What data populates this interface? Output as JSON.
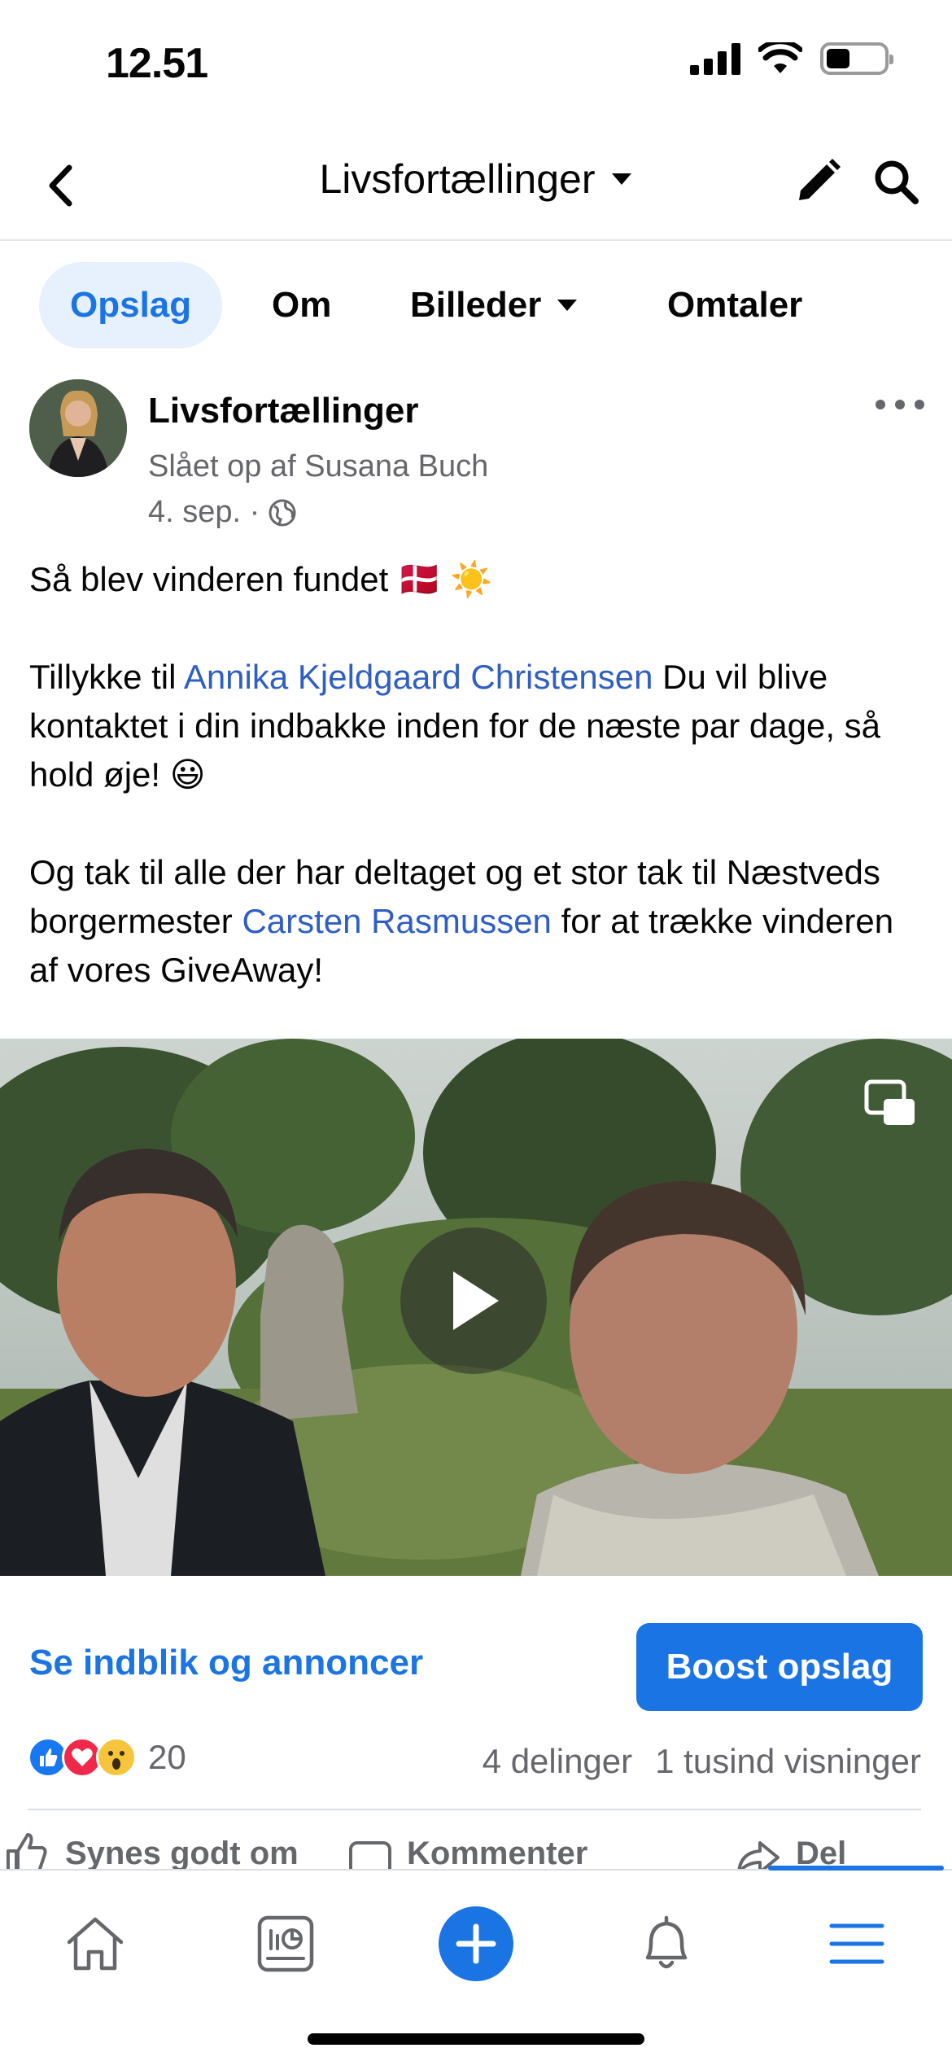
{
  "status_bar": {
    "time": "12.51"
  },
  "nav": {
    "title": "Livsfortællinger"
  },
  "tabs": [
    {
      "label": "Opslag",
      "active": true
    },
    {
      "label": "Om"
    },
    {
      "label": "Billeder"
    },
    {
      "label": "Omtaler"
    }
  ],
  "post": {
    "page_name": "Livsfortællinger",
    "posted_by": "Slået op af Susana Buch",
    "date": "4. sep. ·",
    "line1": "Så blev vinderen fundet 🇩🇰 ☀️",
    "p2_a": "Tillykke til ",
    "p2_link": "Annika Kjeldgaard Christensen",
    "p2_b": " Du vil blive kontaktet i din indbakke inden for de næste par dage, så hold øje! 😃",
    "p3_a": "Og tak til alle der har deltaget og et stor tak til Næstveds borgermester ",
    "p3_link": "Carsten Rasmussen",
    "p3_b": " for at trække vinderen af vores GiveAway!"
  },
  "actions": {
    "insights": "Se indblik og annoncer",
    "boost": "Boost opslag"
  },
  "stats": {
    "reaction_count": "20",
    "shares": "4 delinger",
    "views": "1 tusind visninger"
  },
  "post_actions": {
    "like": "Synes godt om",
    "comment": "Kommenter",
    "share": "Del"
  },
  "colors": {
    "accent": "#1b74e4",
    "link": "#2f5ec4",
    "muted": "#65676b"
  }
}
